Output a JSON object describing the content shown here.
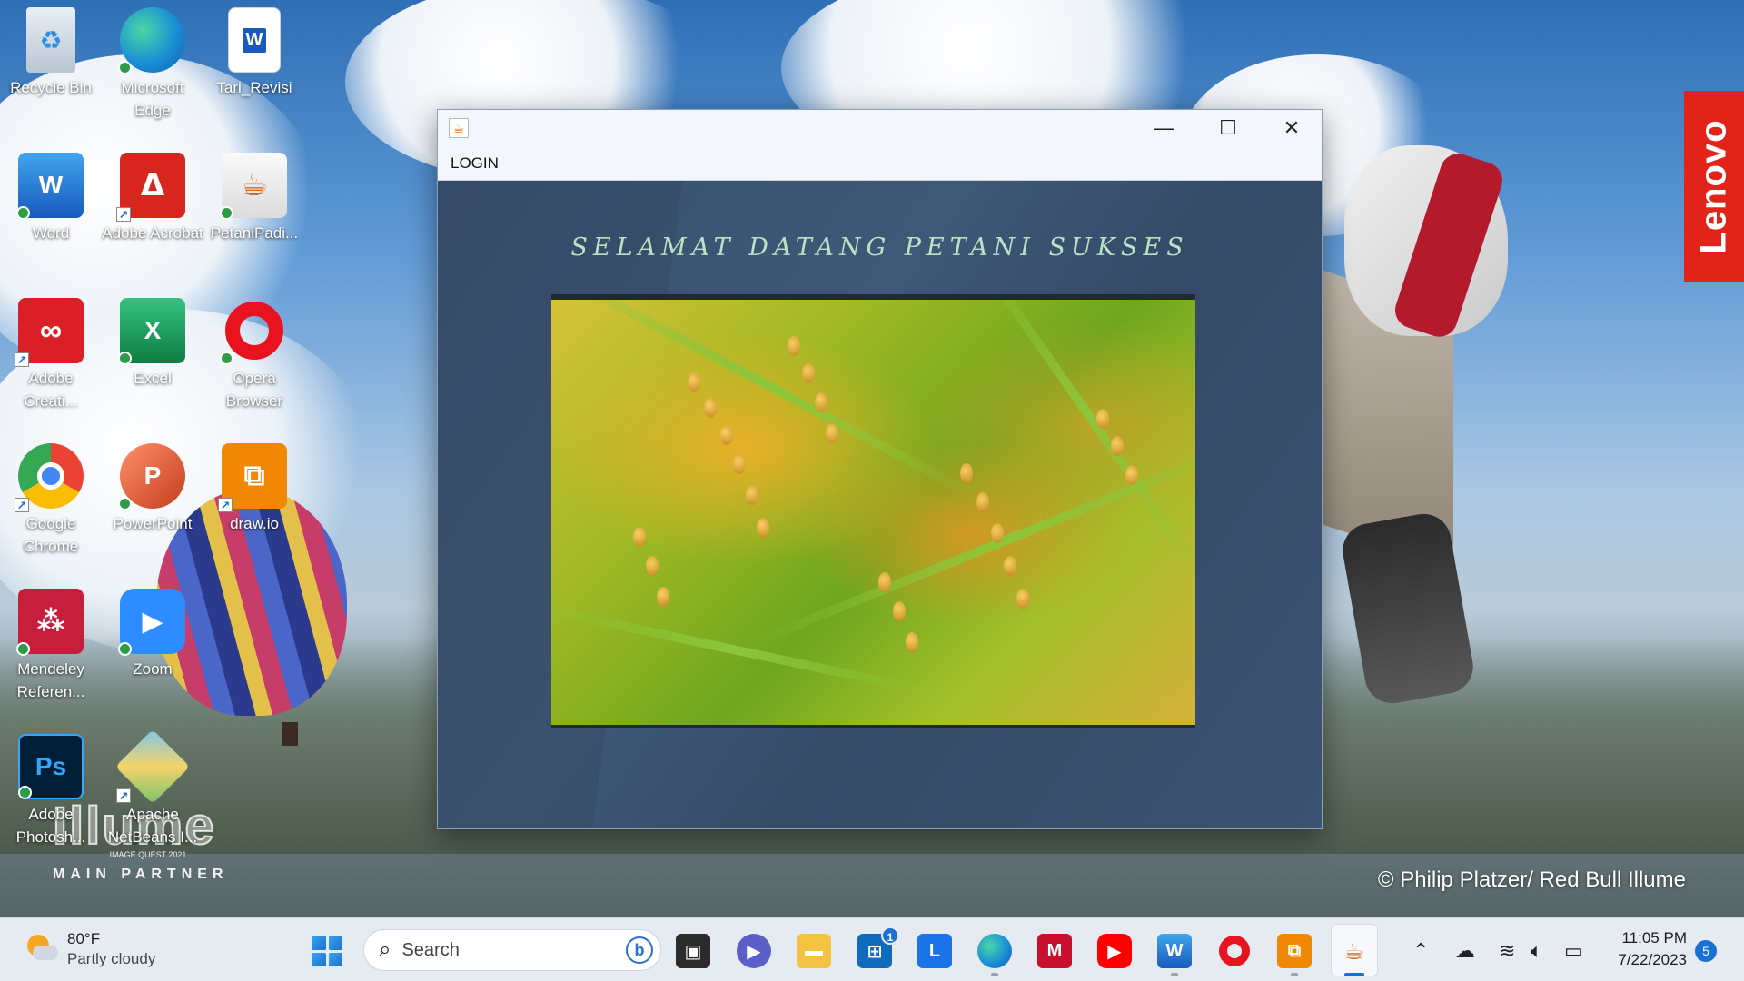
{
  "desktop": {
    "icons": [
      {
        "label": "Recycle Bin",
        "icon": "recycle-bin-icon"
      },
      {
        "label": "Microsoft Edge",
        "icon": "edge-icon"
      },
      {
        "label": "Tari_Revisi",
        "icon": "word-document-icon"
      },
      {
        "label": "Word",
        "icon": "word-icon"
      },
      {
        "label": "Adobe Acrobat",
        "icon": "acrobat-icon"
      },
      {
        "label": "PetaniPadi...",
        "icon": "java-icon"
      },
      {
        "label": "Adobe Creati...",
        "icon": "creative-cloud-icon"
      },
      {
        "label": "Excel",
        "icon": "excel-icon"
      },
      {
        "label": "Opera Browser",
        "icon": "opera-icon"
      },
      {
        "label": "Google Chrome",
        "icon": "chrome-icon"
      },
      {
        "label": "PowerPoint",
        "icon": "powerpoint-icon"
      },
      {
        "label": "draw.io",
        "icon": "drawio-icon"
      },
      {
        "label": "Mendeley Referen...",
        "icon": "mendeley-icon"
      },
      {
        "label": "Zoom",
        "icon": "zoom-icon"
      },
      {
        "label": "Adobe Photosh...",
        "icon": "photoshop-icon"
      },
      {
        "label": "Apache NetBeans I...",
        "icon": "netbeans-icon"
      }
    ],
    "wallpaper": {
      "brand": "Lenovo",
      "credit": "© Philip Platzer/ Red Bull Illume",
      "illume_logo": "Illume",
      "illume_sub": "IMAGE QUEST 2021",
      "illume_partner": "MAIN PARTNER"
    }
  },
  "window": {
    "menu": [
      "LOGIN"
    ],
    "welcome_text": "SELAMAT DATANG PETANI SUKSES",
    "controls": {
      "minimize": "—",
      "maximize": "☐",
      "close": "✕"
    }
  },
  "taskbar": {
    "weather": {
      "temp": "80°F",
      "condition": "Partly cloudy"
    },
    "search_placeholder": "Search",
    "store_badge": "1",
    "clock": {
      "time": "11:05 PM",
      "date": "7/22/2023"
    },
    "notification_count": "5"
  },
  "colors": {
    "window_bg": "#3d5574",
    "welcome_text": "#b9e2c4",
    "taskbar_bg": "#e6ebf2",
    "accent": "#1a6fd3"
  }
}
